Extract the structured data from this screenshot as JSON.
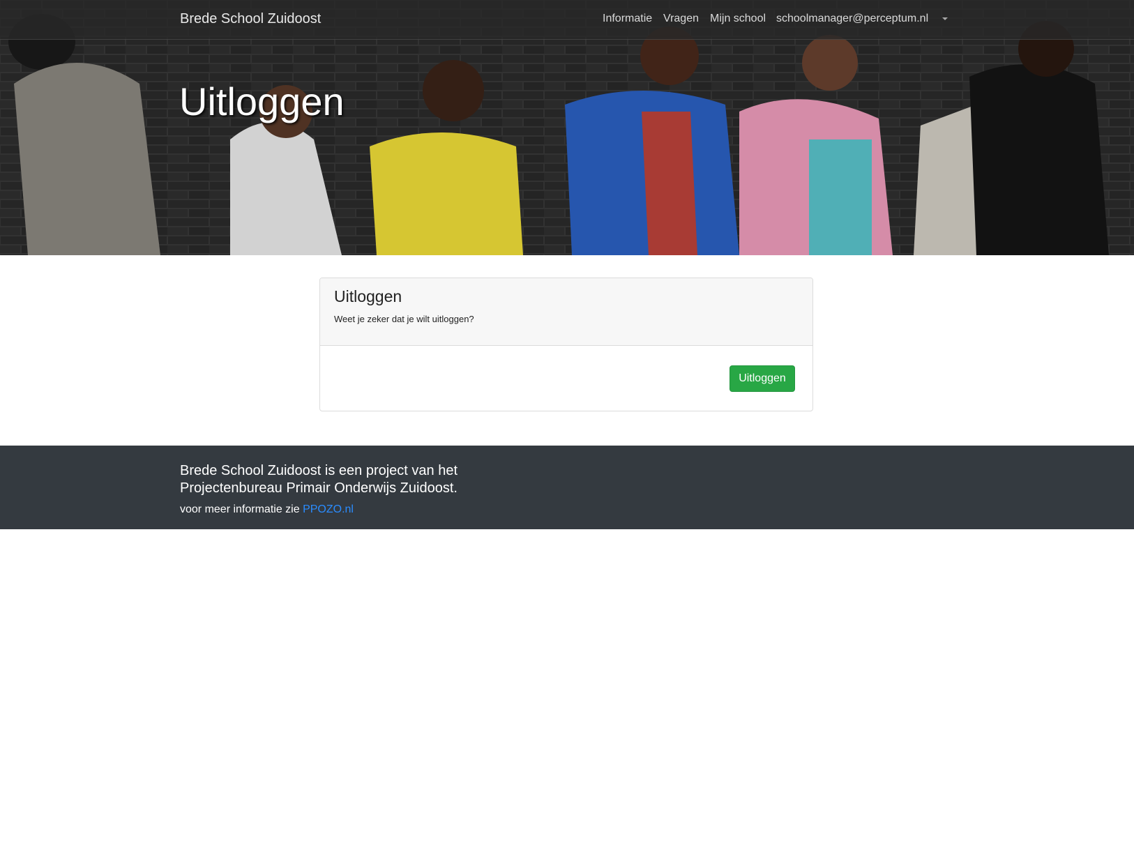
{
  "navbar": {
    "brand": "Brede School Zuidoost",
    "links": [
      {
        "label": "Informatie"
      },
      {
        "label": "Vragen"
      },
      {
        "label": "Mijn school"
      },
      {
        "label": "schoolmanager@perceptum.nl"
      }
    ],
    "dropdown_icon": "caret-down-icon"
  },
  "hero": {
    "title": "Uitloggen"
  },
  "card": {
    "title": "Uitloggen",
    "subtitle": "Weet je zeker dat je wilt uitloggen?",
    "button_label": "Uitloggen",
    "button_color": "#28a745"
  },
  "footer": {
    "text": "Brede School Zuidoost is een project van het Projectenbureau Primair Onderwijs Zuidoost.",
    "info_prefix": "voor meer informatie zie",
    "link_label": "PPOZO.nl",
    "background": "#343a40",
    "link_color": "#2a8cff"
  }
}
